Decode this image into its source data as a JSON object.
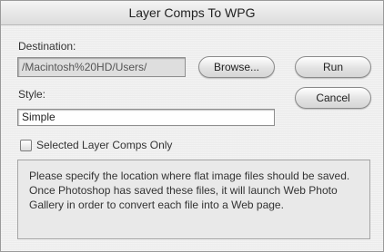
{
  "window": {
    "title": "Layer Comps To WPG"
  },
  "destination": {
    "label": "Destination:",
    "path": "/Macintosh%20HD/Users/",
    "browse_label": "Browse..."
  },
  "style": {
    "label": "Style:",
    "value": "Simple"
  },
  "buttons": {
    "run_label": "Run",
    "cancel_label": "Cancel"
  },
  "options": {
    "selected_only_label": "Selected Layer Comps Only",
    "selected_only_checked": false
  },
  "info": {
    "text": "Please specify the location where flat image files should be saved. Once Photoshop has saved these files, it will launch Web Photo Gallery in order to convert each file into a Web page."
  }
}
